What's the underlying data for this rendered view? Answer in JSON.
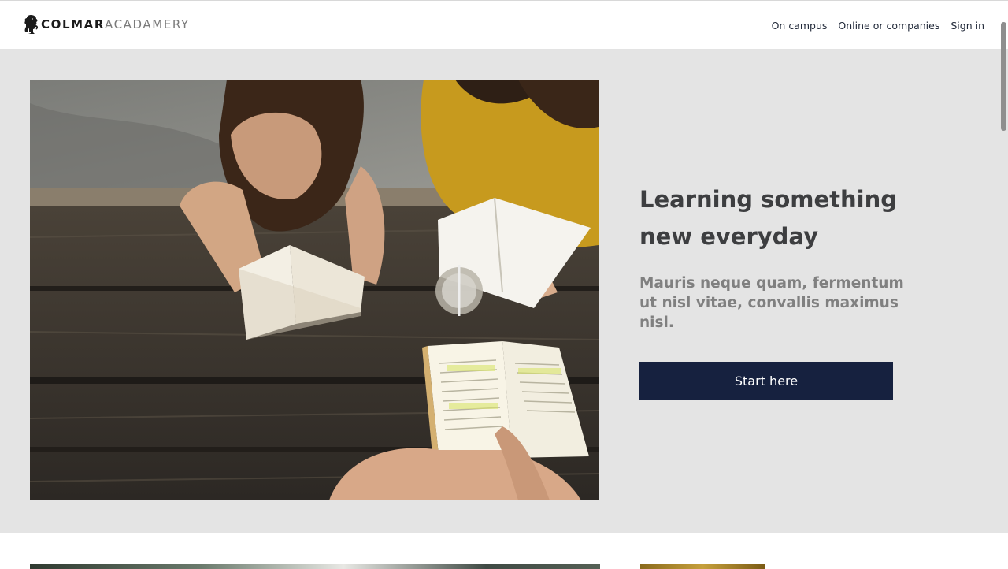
{
  "brand": {
    "name_bold": "COLMAR",
    "name_light": "ACADAMERY",
    "icon": "lion-icon"
  },
  "nav": {
    "items": [
      {
        "label": "On campus"
      },
      {
        "label": "Online or companies"
      },
      {
        "label": "Sign in"
      }
    ]
  },
  "hero": {
    "image": "students-studying-at-table-photo",
    "headline": "Learning something new everyday",
    "subtext": "Mauris neque quam, fermentum ut nisl vitae, convallis maximus nisl.",
    "cta_label": "Start here"
  },
  "colors": {
    "cta": "#16213f",
    "hero_bg": "#e4e4e4",
    "headline": "#3d3e40",
    "subtext": "#808080"
  }
}
